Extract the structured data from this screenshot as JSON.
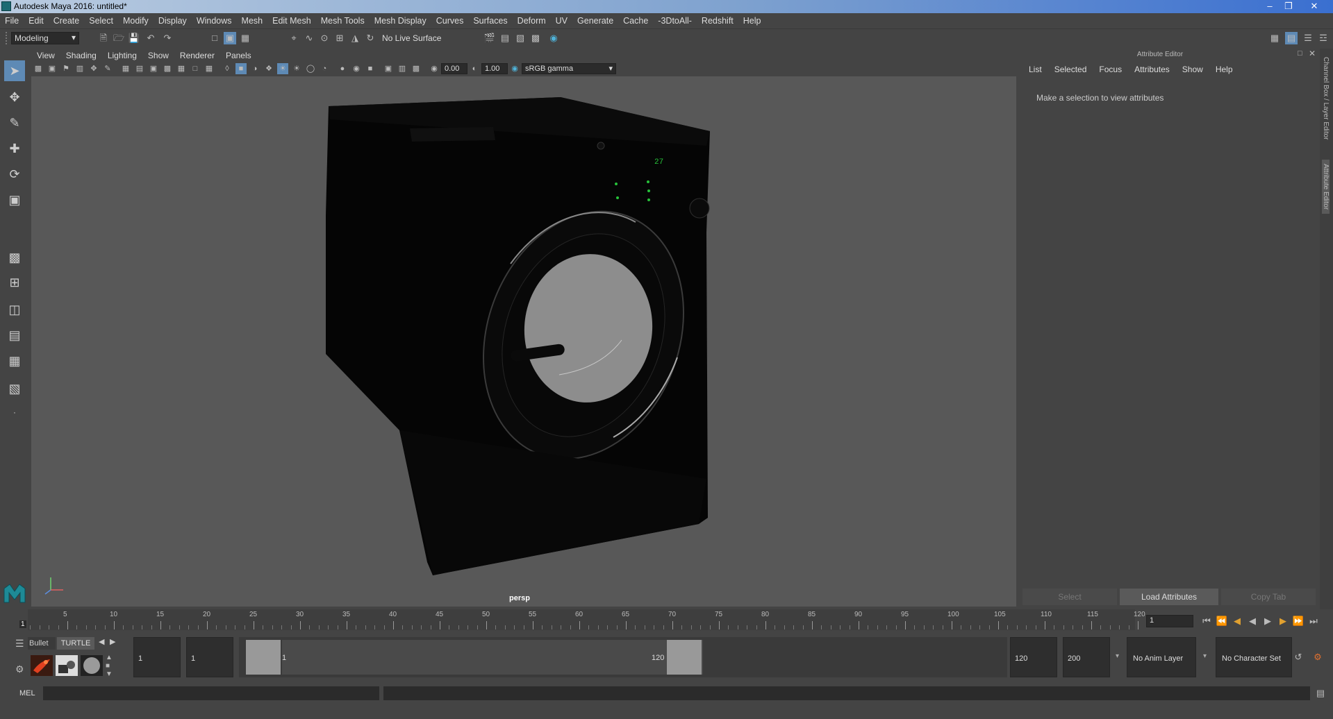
{
  "window": {
    "title": "Autodesk Maya 2016: untitled*"
  },
  "menubar": [
    "File",
    "Edit",
    "Create",
    "Select",
    "Modify",
    "Display",
    "Windows",
    "Mesh",
    "Edit Mesh",
    "Mesh Tools",
    "Mesh Display",
    "Curves",
    "Surfaces",
    "Deform",
    "UV",
    "Generate",
    "Cache",
    "-3DtoAll-",
    "Redshift",
    "Help"
  ],
  "statusline": {
    "menuset": "Modeling",
    "live_surface": "No Live Surface"
  },
  "panel": {
    "menus": [
      "View",
      "Shading",
      "Lighting",
      "Show",
      "Renderer",
      "Panels"
    ],
    "exposure": "0.00",
    "gamma": "1.00",
    "color_space": "sRGB gamma",
    "camera": "persp"
  },
  "scene": {
    "display_digits": "27"
  },
  "attribute_editor": {
    "title": "Attribute Editor",
    "menus": [
      "List",
      "Selected",
      "Focus",
      "Attributes",
      "Show",
      "Help"
    ],
    "message": "Make a selection to view attributes",
    "buttons": {
      "select": "Select",
      "load": "Load Attributes",
      "copy": "Copy Tab"
    },
    "side_tabs": [
      "Channel Box / Layer Editor",
      "Attribute Editor"
    ]
  },
  "timeslider": {
    "ticks": [
      "5",
      "10",
      "15",
      "20",
      "25",
      "30",
      "35",
      "40",
      "45",
      "50",
      "55",
      "60",
      "65",
      "70",
      "75",
      "80",
      "85",
      "90",
      "95",
      "100",
      "105",
      "110",
      "115",
      "120"
    ],
    "start_marker": "1",
    "current_frame": "1"
  },
  "range": {
    "shelf_tabs": [
      "Bullet",
      "TURTLE"
    ],
    "start": "1",
    "playback_start": "1",
    "range_start_label": "1",
    "range_end_label": "120",
    "playback_end": "120",
    "end": "200",
    "anim_layer": "No Anim Layer",
    "character_set": "No Character Set"
  },
  "cmdline": {
    "label": "MEL"
  }
}
